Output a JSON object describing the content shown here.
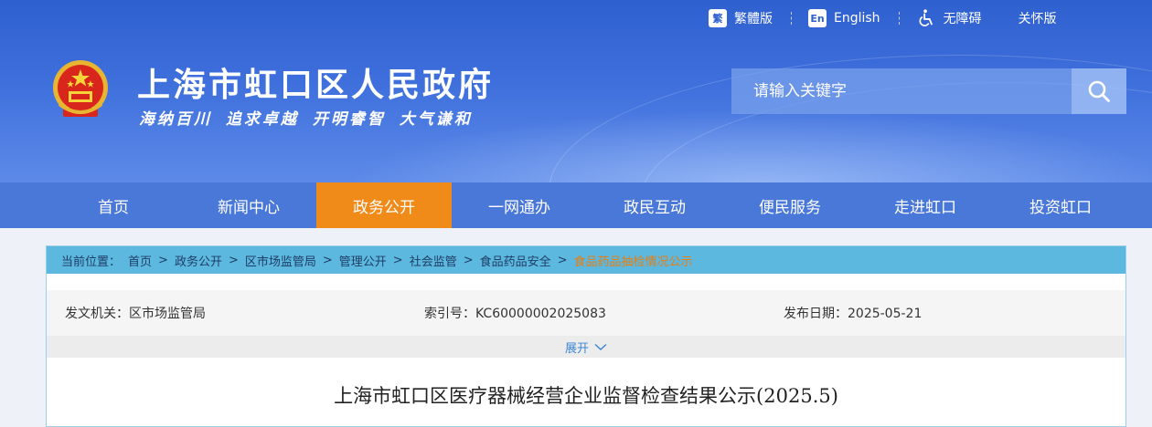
{
  "header": {
    "site_title": "上海市虹口区人民政府",
    "slogan": "海纳百川 追求卓越 开明睿智 大气谦和",
    "top_links": {
      "traditional": "繁體版",
      "traditional_icon_text": "繁",
      "english": "English",
      "english_icon_text": "En",
      "accessibility": "无障碍",
      "care": "关怀版"
    },
    "search": {
      "placeholder": "请输入关键字"
    }
  },
  "nav": {
    "items": [
      {
        "label": "首页"
      },
      {
        "label": "新闻中心"
      },
      {
        "label": "政务公开"
      },
      {
        "label": "一网通办"
      },
      {
        "label": "政民互动"
      },
      {
        "label": "便民服务"
      },
      {
        "label": "走进虹口"
      },
      {
        "label": "投资虹口"
      }
    ],
    "active": "政务公开"
  },
  "breadcrumb": {
    "label": "当前位置：",
    "items": [
      "首页",
      "政务公开",
      "区市场监管局",
      "管理公开",
      "社会监管",
      "食品药品安全"
    ],
    "current": "食品药品抽检情况公示"
  },
  "meta": {
    "issuer": "发文机关：区市场监管局",
    "index_no": "索引号：KC60000002025083",
    "publish_date": "发布日期：2025-05-21"
  },
  "expand_label": "展开",
  "document": {
    "title": "上海市虹口区医疗器械经营企业监督检查结果公示(2025.5)"
  },
  "colors": {
    "header_blue": "#3e6fdc",
    "nav_blue": "#4a78d8",
    "nav_active": "#f08a19",
    "breadcrumb_bar": "#5cb8df",
    "breadcrumb_current": "#e67e10"
  }
}
